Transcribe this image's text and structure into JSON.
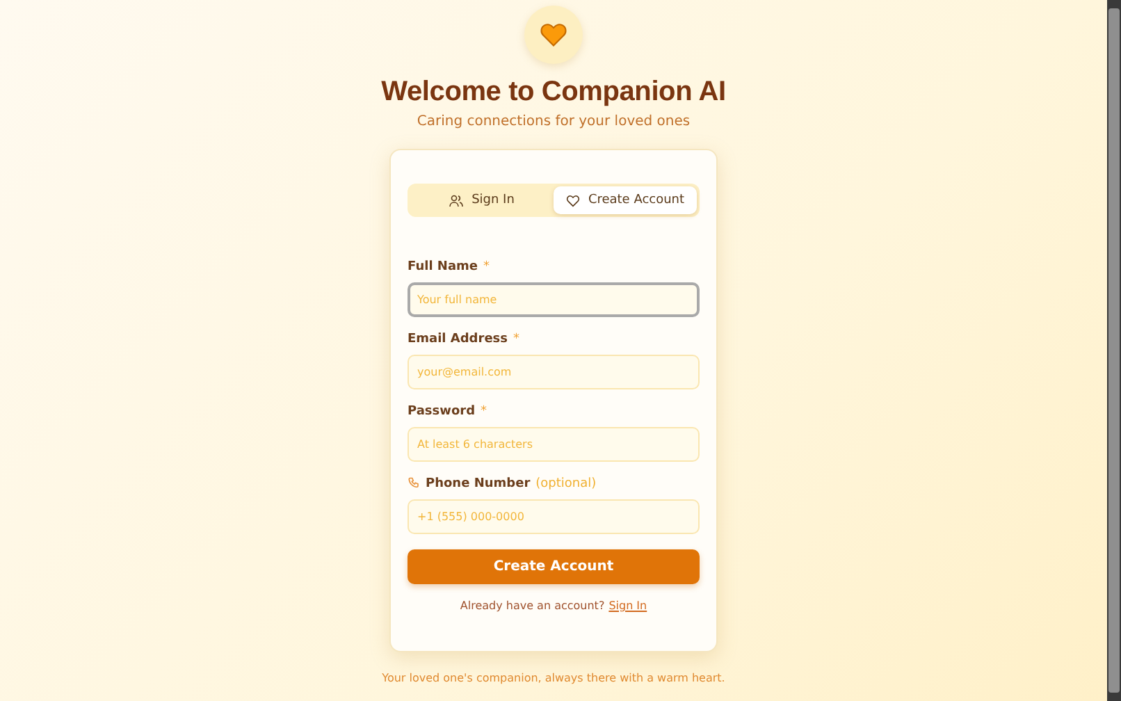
{
  "header": {
    "title": "Welcome to Companion AI",
    "subtitle": "Caring connections for your loved ones"
  },
  "tabs": [
    {
      "label": "Sign In",
      "kind": "people",
      "selected": false
    },
    {
      "label": "Create Account",
      "kind": "heart",
      "selected": true
    }
  ],
  "fields": [
    {
      "kind": "text",
      "label": "Full Name",
      "marker": "*",
      "placeholder": "Your full name",
      "focused": true
    },
    {
      "kind": "text",
      "label": "Email Address",
      "marker": "*",
      "placeholder": "your@email.com",
      "focused": false
    },
    {
      "kind": "text",
      "label": "Password",
      "marker": "*",
      "placeholder": "At least 6 characters",
      "focused": false
    },
    {
      "kind": "phone",
      "label": "Phone Number",
      "note": "(optional)",
      "placeholder": "+1 (555) 000-0000",
      "focused": false
    }
  ],
  "submit": "Create Account",
  "switch_prompt": {
    "text": "Already have an account?",
    "link": "Sign In"
  },
  "footer": "Your loved one's companion, always there with a warm heart."
}
